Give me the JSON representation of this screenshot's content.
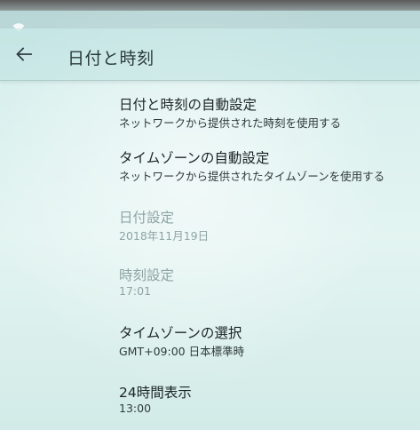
{
  "status_bar": {
    "wifi_icon": "wifi-icon"
  },
  "app_bar": {
    "back_icon": "arrow-left-icon",
    "title": "日付と時刻"
  },
  "settings": [
    {
      "title": "日付と時刻の自動設定",
      "summary": "ネットワークから提供された時刻を使用する",
      "enabled": true
    },
    {
      "title": "タイムゾーンの自動設定",
      "summary": "ネットワークから提供されたタイムゾーンを使用する",
      "enabled": true
    },
    {
      "title": "日付設定",
      "summary": "2018年11月19日",
      "enabled": false
    },
    {
      "title": "時刻設定",
      "summary": "17:01",
      "enabled": false
    },
    {
      "title": "タイムゾーンの選択",
      "summary": "GMT+09:00 日本標準時",
      "enabled": true
    },
    {
      "title": "24時間表示",
      "summary": "13:00",
      "enabled": true
    }
  ],
  "colors": {
    "background": "#d6eeec",
    "title_text": "#2a3a3c",
    "enabled_text": "#1c2426",
    "disabled_text": "#8ea4a5"
  }
}
